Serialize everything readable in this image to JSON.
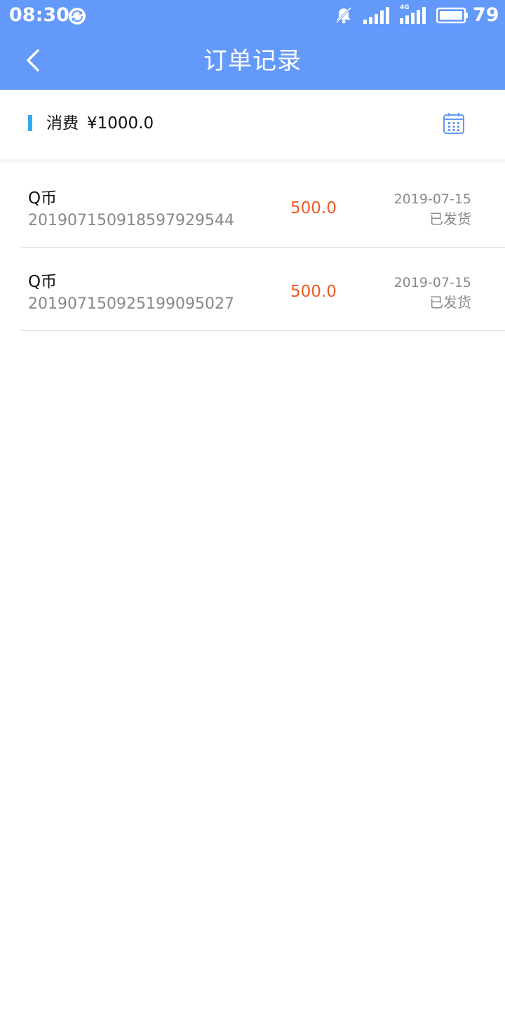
{
  "status_bar": {
    "time": "08:30",
    "battery": "79",
    "network_label": "4G",
    "icons": [
      "sync-icon",
      "mute-icon",
      "signal-icon",
      "signal-4g-icon",
      "battery-icon"
    ]
  },
  "nav": {
    "title": "订单记录",
    "back_icon": "chevron-left-icon"
  },
  "summary": {
    "label": "消费",
    "amount": "¥1000.0",
    "calendar_icon": "calendar-icon"
  },
  "orders": [
    {
      "name": "Q币",
      "number": "20190715091859 7929544",
      "price": "500.0",
      "date": "2019-07-15",
      "status": "已发货"
    },
    {
      "name": "Q币",
      "number": "20190715092519 9095027",
      "price": "500.0",
      "date": "2019-07-15",
      "status": "已发货"
    }
  ],
  "colors": {
    "header": "#6399fb",
    "accent_bar": "#33aaf0",
    "price": "#ee5a24",
    "muted_text": "#888888"
  }
}
